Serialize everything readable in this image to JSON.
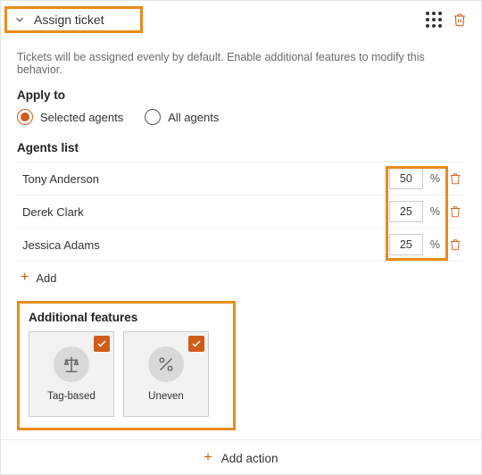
{
  "header": {
    "title": "Assign ticket"
  },
  "description": "Tickets will be assigned evenly by default. Enable additional features to modify this behavior.",
  "apply_to": {
    "title": "Apply to",
    "options": {
      "selected_agents": "Selected agents",
      "all_agents": "All agents"
    },
    "selected": "selected_agents"
  },
  "agents": {
    "title": "Agents list",
    "rows": [
      {
        "name": "Tony Anderson",
        "percent": "50"
      },
      {
        "name": "Derek Clark",
        "percent": "25"
      },
      {
        "name": "Jessica Adams",
        "percent": "25"
      }
    ],
    "percent_sign": "%",
    "add_label": "Add"
  },
  "features": {
    "title": "Additional features",
    "items": [
      {
        "label": "Tag-based",
        "checked": true,
        "icon": "balance"
      },
      {
        "label": "Uneven",
        "checked": true,
        "icon": "percent"
      }
    ]
  },
  "footer": {
    "add_action": "Add action"
  },
  "colors": {
    "accent": "#d15c1a",
    "highlight": "#e88b1a"
  }
}
